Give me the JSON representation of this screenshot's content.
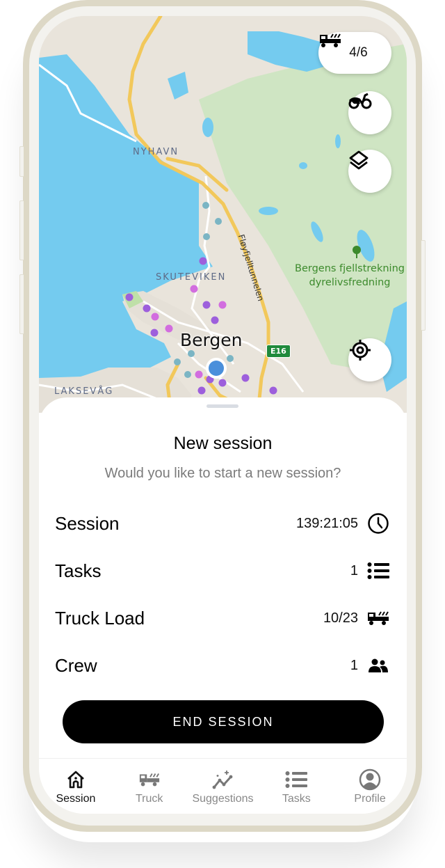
{
  "map": {
    "labels": {
      "nyhavn": "NYHAVN",
      "skuteviken": "SKUTEVIKEN",
      "laksevag": "LAKSEVÅG",
      "city": "Bergen",
      "tunnel": "Fløyfjelltunnelen",
      "road_shield": "E16",
      "park_line1": "Bergens fjellstrekning",
      "park_line2": "dyrelivsfredning"
    },
    "controls": {
      "truck_count": "4/6",
      "bike_icon": "bike-icon",
      "layers_icon": "layers-icon",
      "locate_icon": "crosshair-icon"
    },
    "colors": {
      "water": "#74cbef",
      "land": "#e9e4db",
      "park": "#cfe5c3",
      "road": "#f2c85b",
      "marker_purple": "#9d5fdc",
      "marker_pink": "#d26ddf",
      "marker_teal": "#7bb5c4",
      "user_location": "#4a8fdb"
    }
  },
  "sheet": {
    "title": "New session",
    "subtitle": "Would you like to start a new session?",
    "stats": [
      {
        "label": "Session",
        "value": "139:21:05",
        "icon": "clock-icon"
      },
      {
        "label": "Tasks",
        "value": "1",
        "icon": "list-icon"
      },
      {
        "label": "Truck Load",
        "value": "10/23",
        "icon": "truck-icon"
      },
      {
        "label": "Crew",
        "value": "1",
        "icon": "people-icon"
      }
    ],
    "end_button": "END SESSION"
  },
  "tabbar": {
    "active": "Session",
    "tabs": [
      {
        "label": "Session",
        "icon": "home-icon"
      },
      {
        "label": "Truck",
        "icon": "truck-icon"
      },
      {
        "label": "Suggestions",
        "icon": "sparkle-chart-icon"
      },
      {
        "label": "Tasks",
        "icon": "list-icon"
      },
      {
        "label": "Profile",
        "icon": "profile-icon"
      }
    ]
  }
}
